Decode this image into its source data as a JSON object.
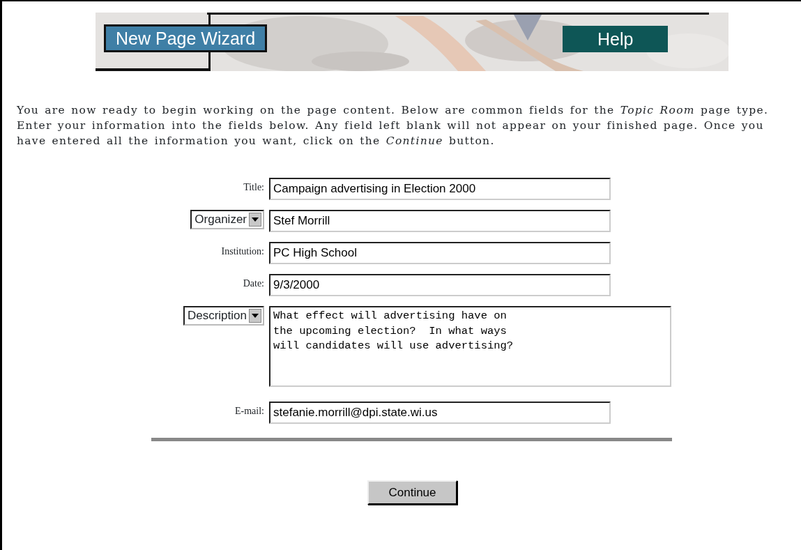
{
  "banner": {
    "title": "New Page Wizard",
    "help": "Help",
    "kind": "picture"
  },
  "intro": "You are now ready to begin working on the page content. Below are common fields for the *Topic Room* page type. Enter your information into the fields below. Any field left blank will not appear on your finished page. Once you have entered all the information you want, click on the *Continue* button.",
  "fields": [
    {
      "kind": "label",
      "label": "Title:",
      "multiline": false,
      "value": "Campaign advertising in Election 2000"
    },
    {
      "kind": "select",
      "label": "Organizer",
      "multiline": false,
      "value": "Stef Morrill"
    },
    {
      "kind": "label",
      "label": "Institution:",
      "multiline": false,
      "value": "PC High School"
    },
    {
      "kind": "label",
      "label": "Date:",
      "multiline": false,
      "value": "9/3/2000"
    },
    {
      "kind": "select",
      "label": "Description",
      "multiline": true,
      "value": "What effect will advertising have on\nthe upcoming election?  In what ways\nwill candidates will use advertising?"
    },
    {
      "kind": "label",
      "label": "E-mail:",
      "multiline": false,
      "value": "stefanie.morrill@dpi.state.wi.us"
    }
  ],
  "button": "Continue"
}
